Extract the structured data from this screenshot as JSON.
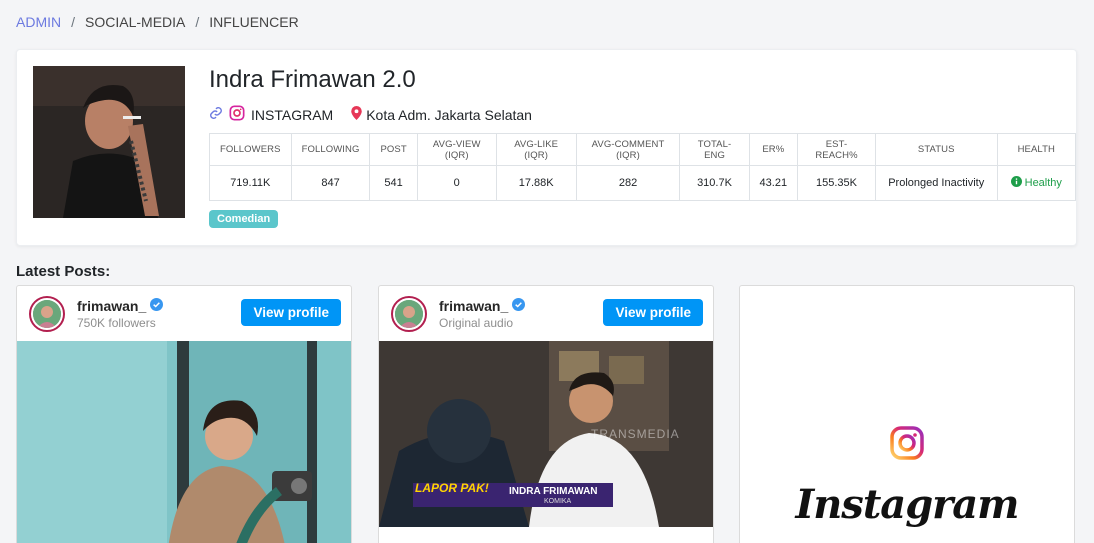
{
  "breadcrumb": {
    "admin": "ADMIN",
    "social_media": "SOCIAL-MEDIA",
    "influencer": "INFLUENCER",
    "separator": "/"
  },
  "profile": {
    "name": "Indra Frimawan 2.0",
    "platform": "INSTAGRAM",
    "location": "Kota Adm. Jakarta Selatan",
    "tag": "Comedian",
    "icons": {
      "link": "link-icon",
      "platform": "instagram-icon",
      "location": "map-pin-icon",
      "health": "info-circle-icon"
    }
  },
  "stats": {
    "headers": [
      "FOLLOWERS",
      "FOLLOWING",
      "POST",
      "AVG-VIEW (IQR)",
      "AVG-LIKE (IQR)",
      "AVG-COMMENT (IQR)",
      "TOTAL-ENG",
      "ER%",
      "EST-REACH%",
      "STATUS",
      "HEALTH"
    ],
    "values": [
      "719.11K",
      "847",
      "541",
      "0",
      "17.88K",
      "282",
      "310.7K",
      "43.21",
      "155.35K",
      "Prolonged Inactivity",
      "Healthy"
    ]
  },
  "latest_posts_title": "Latest Posts:",
  "posts": [
    {
      "username": "frimawan_",
      "subtitle": "750K followers",
      "button": "View profile"
    },
    {
      "username": "frimawan_",
      "subtitle": "Original audio",
      "button": "View profile",
      "overlay_left": "LAPOR PAK!",
      "overlay_name": "INDRA FRIMAWAN",
      "overlay_sub": "KOMIKA",
      "watermark": "TRANSMEDIA"
    }
  ],
  "embed": {
    "wordmark": "Instagram"
  },
  "colors": {
    "accent": "#0095f6",
    "breadcrumb_link": "#6c7ae0",
    "tag": "#5bc6cb",
    "healthy": "#1e9e4a"
  }
}
